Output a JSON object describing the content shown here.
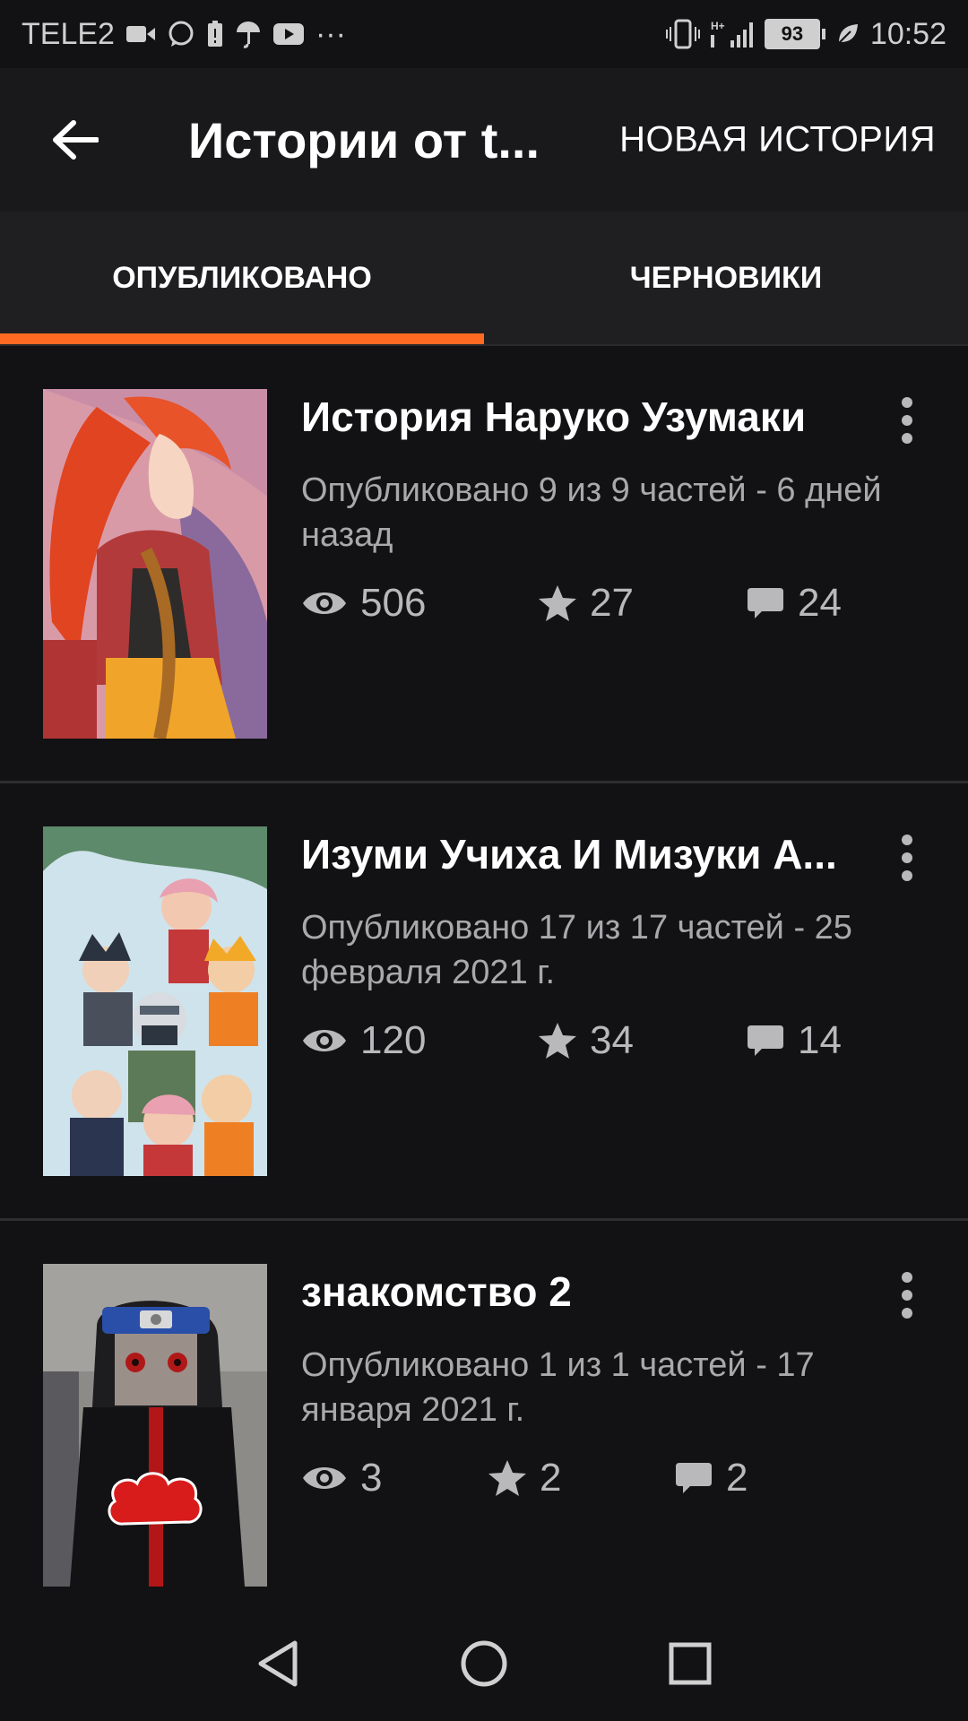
{
  "status_bar": {
    "carrier": "TELE2",
    "notification_icons": [
      "video-camera-icon",
      "whatsapp-icon",
      "battery-saver-icon",
      "umbrella-icon",
      "youtube-icon",
      "more-dots-icon"
    ],
    "more_label": "···",
    "network_label": "H+",
    "battery_level": "93",
    "time": "10:52"
  },
  "app_bar": {
    "title": "Истории от t...",
    "action_label": "НОВАЯ ИСТОРИЯ"
  },
  "tabs": [
    {
      "label": "ОПУБЛИКОВАНО",
      "active": true
    },
    {
      "label": "ЧЕРНОВИКИ",
      "active": false
    }
  ],
  "accent_color": "#ff6a22",
  "stories": [
    {
      "title": "История Наруко Узумаки",
      "meta": "Опубликовано 9 из 9 частей - 6 дней назад",
      "views": "506",
      "votes": "27",
      "comments": "24"
    },
    {
      "title": "Изуми Учиха И Мизуки А...",
      "meta": "Опубликовано 17 из 17 частей - 25 февраля 2021 г.",
      "views": "120",
      "votes": "34",
      "comments": "14"
    },
    {
      "title": "знакомство 2",
      "meta": "Опубликовано 1 из 1 частей - 17 января 2021 г.",
      "views": "3",
      "votes": "2",
      "comments": "2"
    }
  ],
  "nav_bar": [
    "back-triangle-icon",
    "home-circle-icon",
    "recents-square-icon"
  ]
}
